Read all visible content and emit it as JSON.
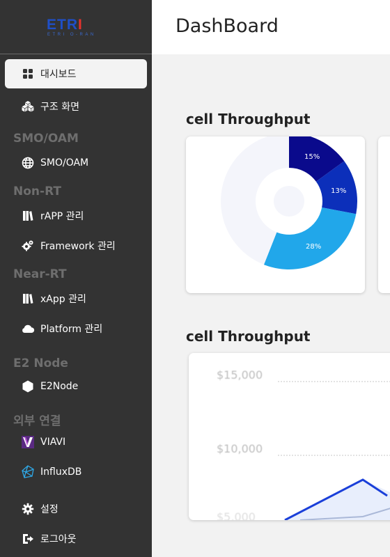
{
  "app": {
    "logo_main": "ETRI",
    "logo_sub": "ETRI O-RAN"
  },
  "header": {
    "title": "DashBoard"
  },
  "sidebar": {
    "items_top": [
      {
        "label": "대시보드",
        "icon": "dashboard-grid-icon",
        "active": true
      },
      {
        "label": "구조 화면",
        "icon": "cubes-icon",
        "active": false
      }
    ],
    "sections": [
      {
        "title": "SMO/OAM",
        "items": [
          {
            "label": "SMO/OAM",
            "icon": "globe-icon"
          }
        ]
      },
      {
        "title": "Non-RT",
        "items": [
          {
            "label": "rAPP 관리",
            "icon": "app-books-icon"
          },
          {
            "label": "Framework 관리",
            "icon": "framework-gear-icon"
          }
        ]
      },
      {
        "title": "Near-RT",
        "items": [
          {
            "label": "xApp 관리",
            "icon": "app-books-icon"
          },
          {
            "label": "Platform 관리",
            "icon": "cloud-icon"
          }
        ]
      },
      {
        "title": "E2 Node",
        "items": [
          {
            "label": "E2Node",
            "icon": "hexagon-icon"
          }
        ]
      },
      {
        "title": "외부 연결",
        "items": [
          {
            "label": "VIAVI",
            "icon": "viavi-logo-icon"
          },
          {
            "label": "InfluxDB",
            "icon": "influxdb-logo-icon"
          }
        ]
      }
    ],
    "items_bottom": [
      {
        "label": "설정",
        "icon": "gear-icon"
      },
      {
        "label": "로그아웃",
        "icon": "logout-icon"
      }
    ]
  },
  "main": {
    "donut_title": "cell Throughput",
    "line_title": "cell Throughput"
  },
  "chart_data": [
    {
      "type": "pie",
      "title": "cell Throughput",
      "slices": [
        {
          "label": "15%",
          "value": 15,
          "color": "#0a0a8c"
        },
        {
          "label": "13%",
          "value": 13,
          "color": "#0c2fba"
        },
        {
          "label": "28%",
          "value": 28,
          "color": "#21a7ea"
        },
        {
          "label": "",
          "value": 44,
          "color": "#f4f5fb"
        }
      ]
    },
    {
      "type": "line",
      "title": "cell Throughput",
      "y_ticks": [
        "$15,000",
        "$10,000",
        "$5,000"
      ],
      "ylim": [
        5000,
        15000
      ],
      "grid": true
    }
  ],
  "colors": {
    "sidebar_bg": "#333333",
    "accent_blue": "#1a3fd9",
    "content_bg": "#f2f2f2"
  }
}
